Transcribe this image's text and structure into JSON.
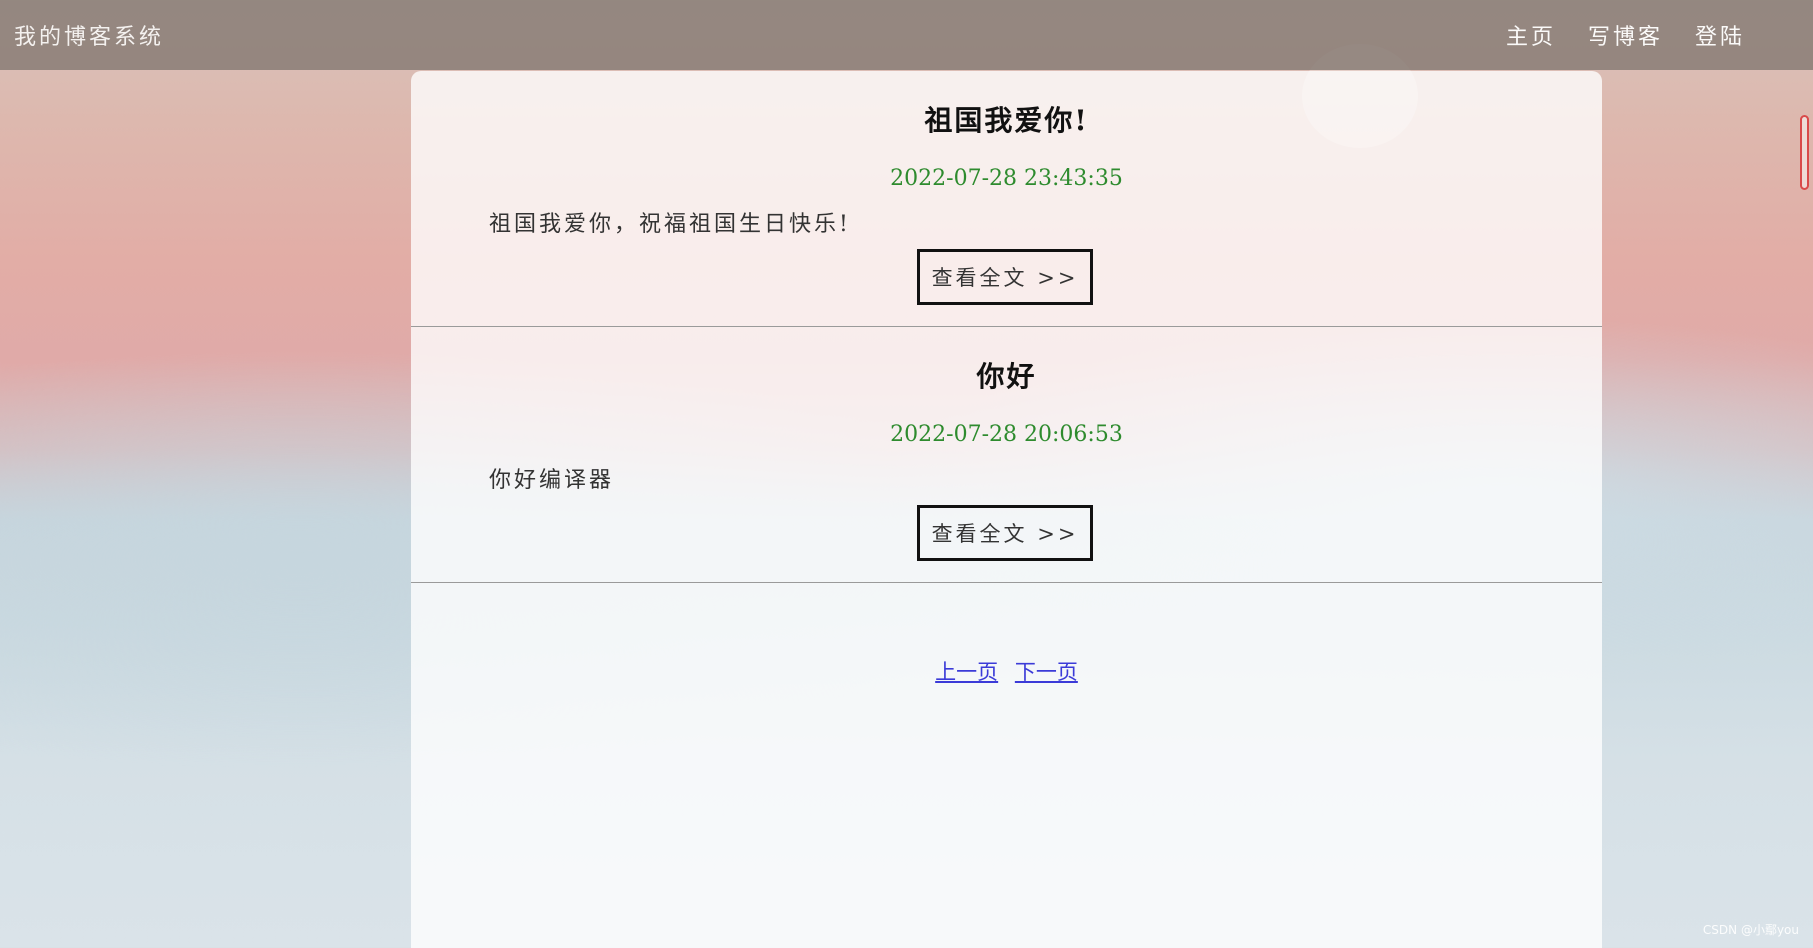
{
  "navbar": {
    "title": "我的博客系统",
    "links": [
      "主页",
      "写博客",
      "登陆"
    ]
  },
  "blogs": [
    {
      "title": "祖国我爱你!",
      "date": "2022-07-28 23:43:35",
      "desc": "祖国我爱你，祝福祖国生日快乐!",
      "button": "查看全文 >>"
    },
    {
      "title": "你好",
      "date": "2022-07-28 20:06:53",
      "desc": "你好编译器",
      "button": "查看全文 >>"
    }
  ],
  "pagination": {
    "prev": "上一页",
    "next": "下一页"
  },
  "watermark": "CSDN @小鄢you",
  "colors": {
    "date": "#2e8b2e",
    "link": "#3b3bd8",
    "navbar": "#887c76"
  }
}
